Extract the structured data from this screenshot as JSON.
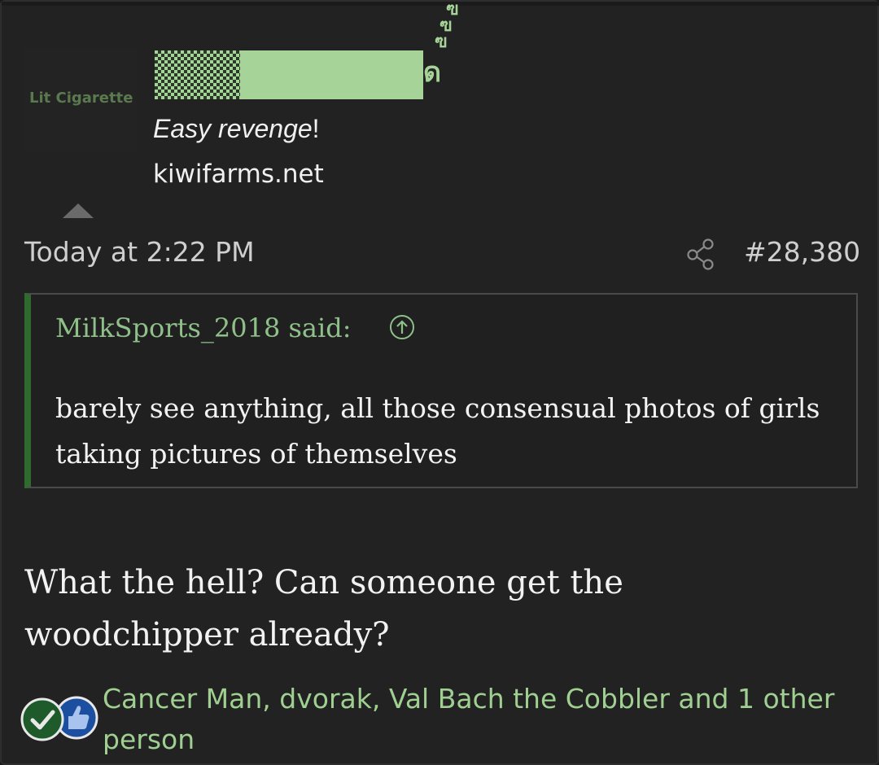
{
  "post": {
    "avatar_alt": "Lit Cigarette",
    "signature": {
      "line1_italic": "Easy revenge",
      "line1_suffix": "!",
      "line2": "kiwifarms.net"
    },
    "date": "Today at 2:22 PM",
    "post_number": "#28,380"
  },
  "quote": {
    "author_line": "MilkSports_2018 said:",
    "body": "barely see anything, all those consensual photos of girls taking pictures of themselves"
  },
  "message": {
    "text": "What the hell? Can someone get the woodchipper already?"
  },
  "reactions": {
    "summary": "Cancer Man, dvorak, Val Bach the Cobbler and 1 other person",
    "icons": [
      "checkmark-icon",
      "thumbs-up-icon"
    ]
  },
  "colors": {
    "background": "#222222",
    "accent_green": "#9fcf91",
    "quote_bar": "#2f6a2f",
    "text": "#f2f2f2",
    "meta_text": "#cfcfcf"
  }
}
